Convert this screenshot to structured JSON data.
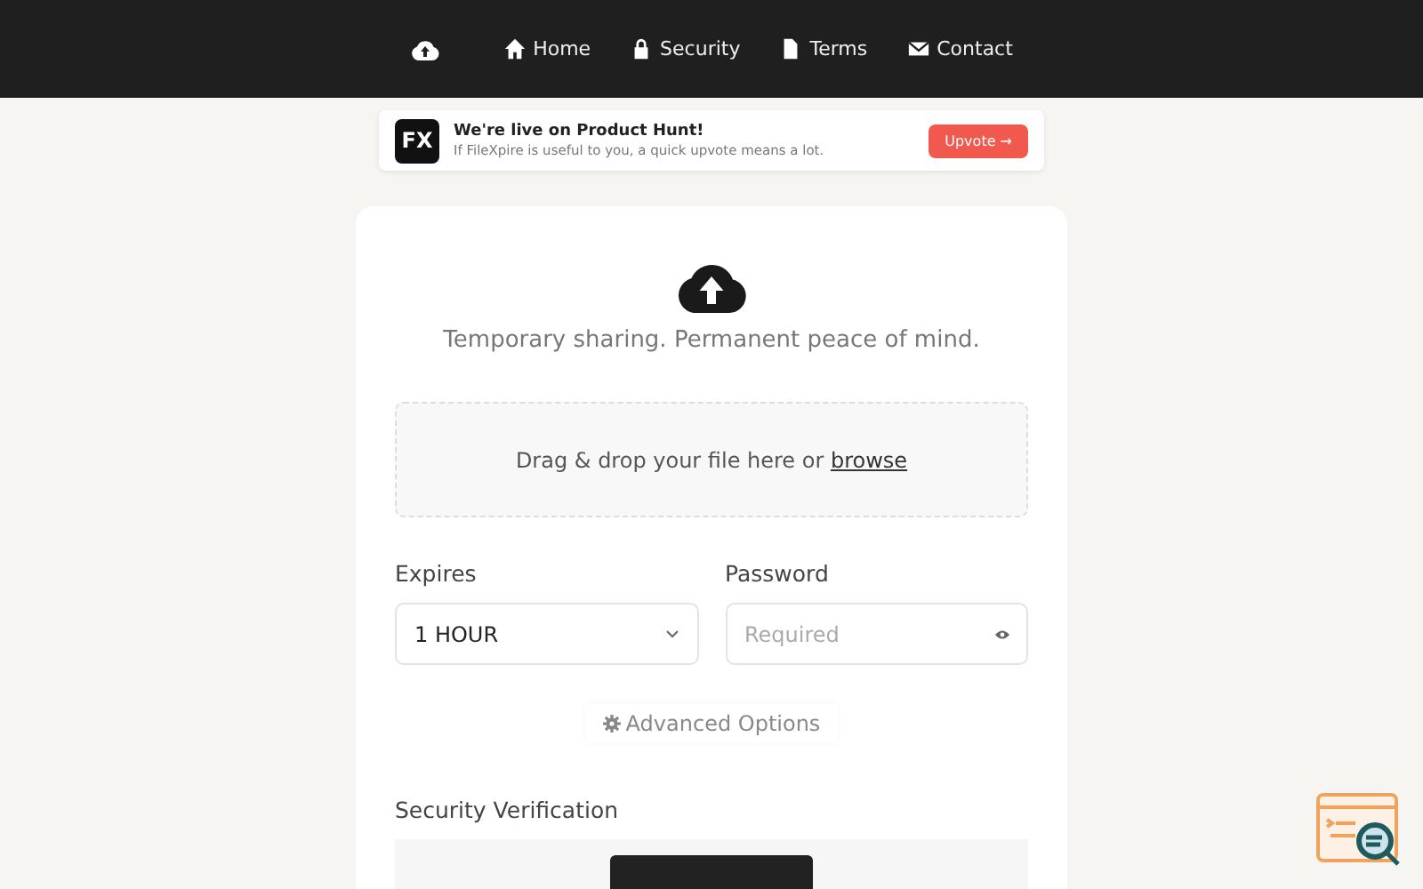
{
  "nav": {
    "items": [
      {
        "label": "Home",
        "kind": "home"
      },
      {
        "label": "Security",
        "kind": "lock"
      },
      {
        "label": "Terms",
        "kind": "document"
      },
      {
        "label": "Contact",
        "kind": "mail"
      }
    ]
  },
  "banner": {
    "logo": "FX",
    "title": "We're live on Product Hunt!",
    "subtitle": "If FileXpire is useful to you, a quick upvote means a lot.",
    "button": "Upvote →"
  },
  "upload": {
    "tagline": "Temporary sharing. Permanent peace of mind.",
    "dropzone_text": "Drag & drop your file here or ",
    "browse_link": "browse"
  },
  "expires": {
    "label": "Expires",
    "value": "1 HOUR"
  },
  "password": {
    "label": "Password",
    "placeholder": "Required"
  },
  "advanced": {
    "label": "Advanced Options"
  },
  "verification": {
    "label": "Security Verification"
  }
}
